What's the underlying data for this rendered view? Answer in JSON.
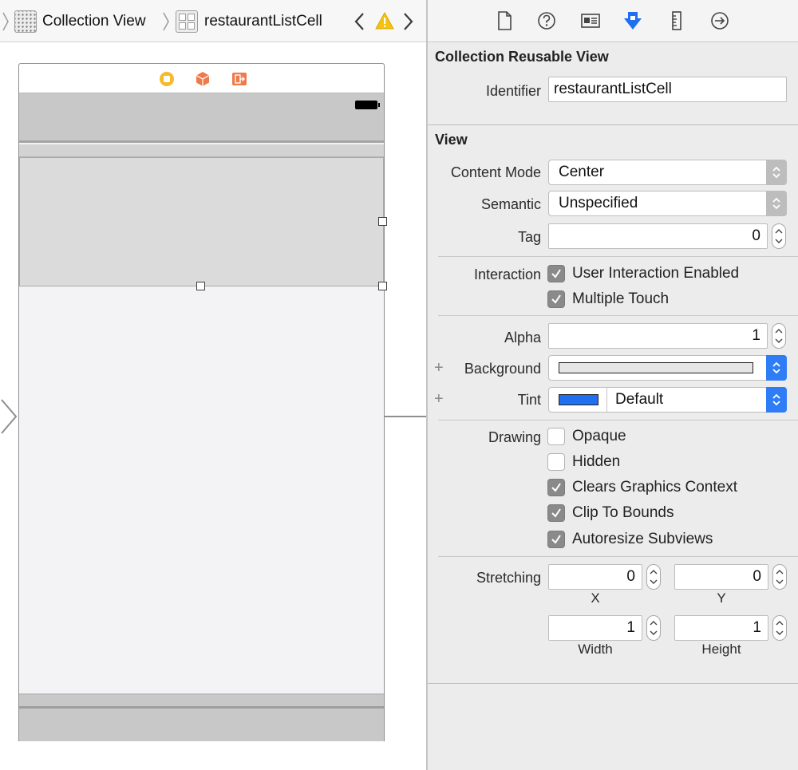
{
  "breadcrumb": {
    "collection_label": "Collection View",
    "cell_label": "restaurantListCell"
  },
  "inspector": {
    "tab_icons": [
      "file-icon",
      "help-icon",
      "identity-icon",
      "attributes-icon",
      "size-icon",
      "connections-icon"
    ],
    "reusable_view": {
      "title": "Collection Reusable View",
      "identifier_label": "Identifier",
      "identifier_value": "restaurantListCell"
    },
    "view": {
      "title": "View",
      "content_mode_label": "Content Mode",
      "content_mode_value": "Center",
      "semantic_label": "Semantic",
      "semantic_value": "Unspecified",
      "tag_label": "Tag",
      "tag_value": "0",
      "interaction_label": "Interaction",
      "user_interaction_label": "User Interaction Enabled",
      "multiple_touch_label": "Multiple Touch",
      "alpha_label": "Alpha",
      "alpha_value": "1",
      "background_label": "Background",
      "tint_label": "Tint",
      "tint_value": "Default",
      "tint_color": "#1f6ff0",
      "drawing_label": "Drawing",
      "opaque_label": "Opaque",
      "hidden_label": "Hidden",
      "clears_label": "Clears Graphics Context",
      "clip_label": "Clip To Bounds",
      "autoresize_label": "Autoresize Subviews",
      "stretching_label": "Stretching",
      "stretch_x": "0",
      "stretch_y": "0",
      "stretch_w": "1",
      "stretch_h": "1",
      "x_label": "X",
      "y_label": "Y",
      "width_label": "Width",
      "height_label": "Height"
    }
  },
  "colors": {
    "accent_blue": "#2f7df6",
    "checkbox_on": "#8a8a8a"
  }
}
